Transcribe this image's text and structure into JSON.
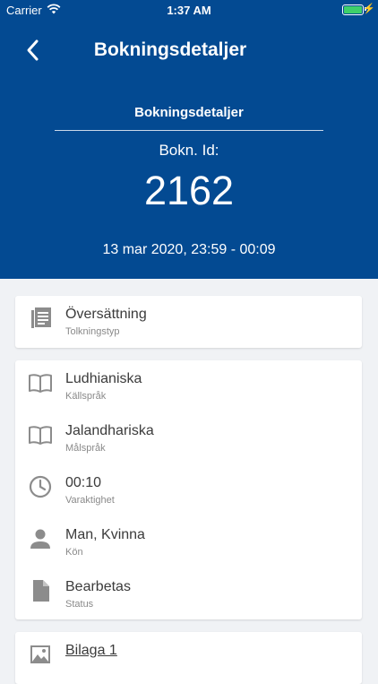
{
  "status_bar": {
    "carrier": "Carrier",
    "time": "1:37 AM"
  },
  "nav": {
    "title": "Bokningsdetaljer"
  },
  "booking": {
    "section_title": "Bokningsdetaljer",
    "id_label": "Bokn. Id:",
    "id_value": "2162",
    "datetime": "13 mar 2020, 23:59 - 00:09"
  },
  "interpretation": {
    "value": "Översättning",
    "label": "Tolkningstyp",
    "icon": "document-list-icon"
  },
  "details": [
    {
      "value": "Ludhianiska",
      "label": "Källspråk",
      "icon": "book-icon"
    },
    {
      "value": "Jalandhariska",
      "label": "Målspråk",
      "icon": "book-icon"
    },
    {
      "value": "00:10",
      "label": "Varaktighet",
      "icon": "clock-icon"
    },
    {
      "value": "Man, Kvinna",
      "label": "Kön",
      "icon": "person-icon"
    },
    {
      "value": "Bearbetas",
      "label": "Status",
      "icon": "file-icon"
    }
  ],
  "attachment": {
    "label": "Bilaga 1",
    "icon": "image-icon"
  },
  "colors": {
    "header_bg": "#034a92",
    "page_bg": "#f0f2f5",
    "icon_gray": "#8c8c8c",
    "battery": "#3ed06a"
  }
}
